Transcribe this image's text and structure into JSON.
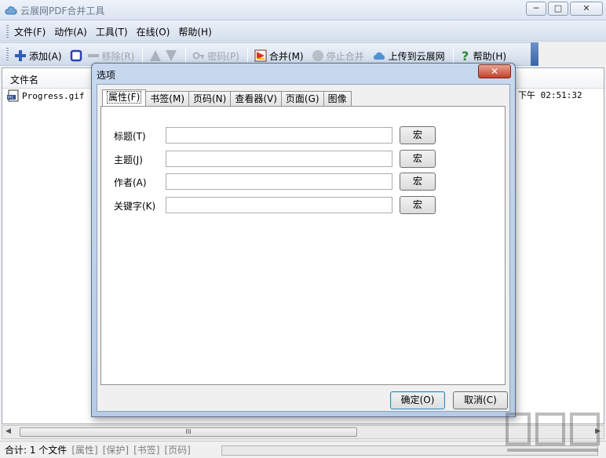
{
  "window": {
    "title": "云展网PDF合并工具",
    "min": "─",
    "max": "□",
    "close": "✕"
  },
  "menu": [
    "文件(F)",
    "动作(A)",
    "工具(T)",
    "在线(O)",
    "帮助(H)"
  ],
  "toolbar": {
    "add": "添加(A)",
    "remove": "移除(R)",
    "password": "密码(P)",
    "merge": "合并(M)",
    "stop": "停止合并",
    "upload": "上传到云展网",
    "help": "帮助(H)"
  },
  "filelist": {
    "header": "文件名",
    "rows": [
      {
        "name": "Progress.gif",
        "time": "下午 02:51:32"
      }
    ]
  },
  "scroll": {
    "grip": "III",
    "left": "◀",
    "right": "▶"
  },
  "status": {
    "count": "合计: 1 个文件",
    "props": "[属性]",
    "protect": "[保护]",
    "bookmark": "[书签]",
    "page": "[页码]"
  },
  "dialog": {
    "title": "选项",
    "close": "✕",
    "tabs": [
      "属性(F)",
      "书签(M)",
      "页码(N)",
      "查看器(V)",
      "页面(G)",
      "图像"
    ],
    "fields": [
      {
        "label": "标题(T)",
        "value": "",
        "macro": "宏"
      },
      {
        "label": "主题(J)",
        "value": "",
        "macro": "宏"
      },
      {
        "label": "作者(A)",
        "value": "",
        "macro": "宏"
      },
      {
        "label": "关键字(K)",
        "value": "",
        "macro": "宏"
      }
    ],
    "ok": "确定(O)",
    "cancel": "取消(C)"
  },
  "colors": {
    "accent": "#3a64a6",
    "close_red": "#c4402b"
  }
}
